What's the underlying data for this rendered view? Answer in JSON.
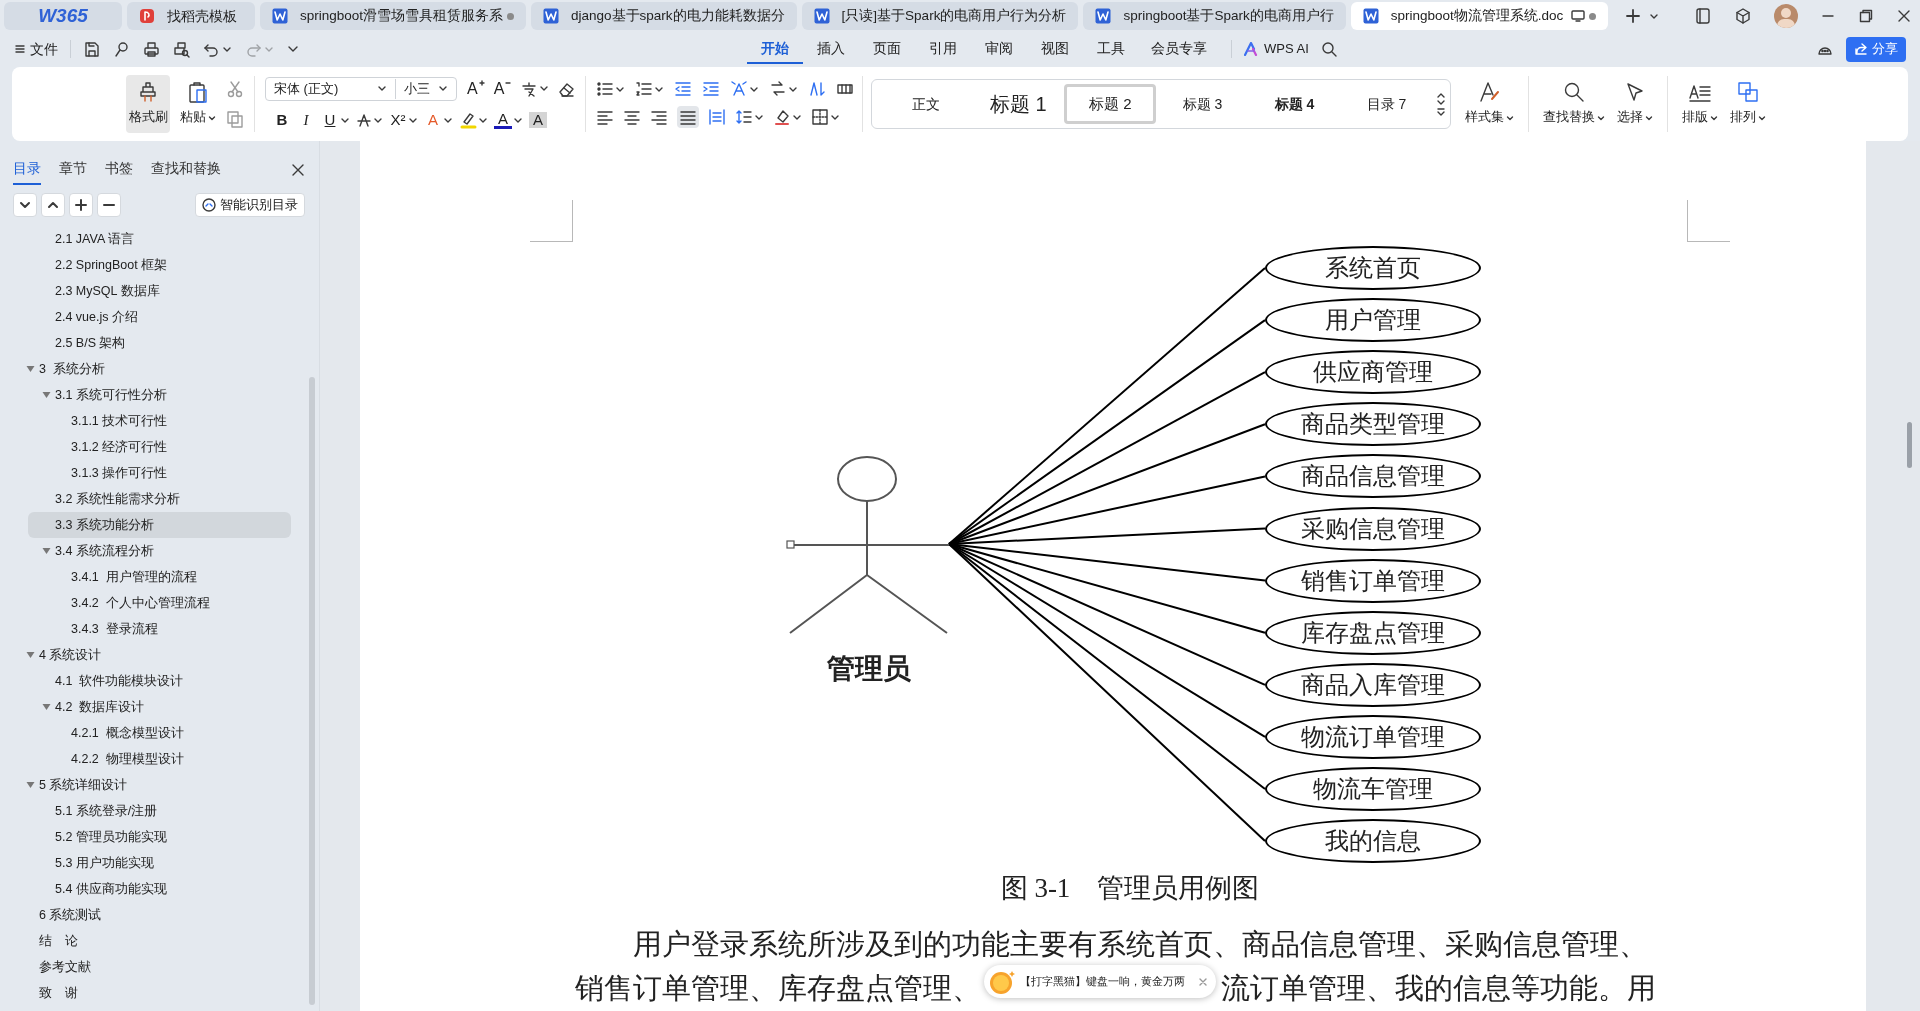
{
  "tabs": [
    {
      "kind": "logo",
      "label": "W365",
      "selected": false
    },
    {
      "kind": "templates",
      "label": "找稻壳模板",
      "selected": false
    },
    {
      "kind": "doc",
      "label": "springboot滑雪场雪具租赁服务系",
      "selected": false,
      "modified": true
    },
    {
      "kind": "doc",
      "label": "django基于spark的电力能耗数据分",
      "selected": false,
      "modified": false
    },
    {
      "kind": "doc",
      "label": "[只读]基于Spark的电商用户行为分析",
      "selected": false,
      "modified": false
    },
    {
      "kind": "doc",
      "label": "springboot基于Spark的电商用户行",
      "selected": false,
      "modified": false
    },
    {
      "kind": "doc",
      "label": "springboot物流管理系统.doc",
      "selected": true,
      "modified": true
    }
  ],
  "file_menu": "文件",
  "ribbon_tabs": [
    {
      "label": "开始",
      "selected": true
    },
    {
      "label": "插入",
      "selected": false
    },
    {
      "label": "页面",
      "selected": false
    },
    {
      "label": "引用",
      "selected": false
    },
    {
      "label": "审阅",
      "selected": false
    },
    {
      "label": "视图",
      "selected": false
    },
    {
      "label": "工具",
      "selected": false
    },
    {
      "label": "会员专享",
      "selected": false
    }
  ],
  "wps_ai": "WPS AI",
  "share": "分享",
  "ribbon": {
    "format_painter": {
      "label": "格式刷",
      "pressed": true
    },
    "paste": "粘贴",
    "font": "宋体 (正文)",
    "font_size": "小三",
    "font_buttons": [
      {
        "kind": "grow",
        "label": "A"
      },
      {
        "kind": "shrink",
        "label": "A"
      }
    ],
    "format_buttons": [
      {
        "kind": "bold",
        "label": "B"
      },
      {
        "kind": "italic",
        "label": "I"
      },
      {
        "kind": "underline",
        "label": "U"
      },
      {
        "kind": "superscript",
        "label": "X²"
      },
      {
        "kind": "effect",
        "label": "A"
      },
      {
        "kind": "color",
        "label": "A"
      },
      {
        "kind": "shade",
        "label": "A"
      }
    ],
    "styles": [
      {
        "kind": "body",
        "label": "正文",
        "selected": false
      },
      {
        "kind": "h1",
        "label": "标题 1",
        "selected": false
      },
      {
        "kind": "h2",
        "label": "标题 2",
        "selected": true
      },
      {
        "kind": "h3",
        "label": "标题 3",
        "selected": false
      },
      {
        "kind": "h4",
        "label": "标题 4",
        "selected": false
      },
      {
        "kind": "toc",
        "label": "目录 7",
        "selected": false
      }
    ],
    "style_set": "样式集",
    "find_replace": "查找替换",
    "select": "选择",
    "layout": "排版",
    "arrange": "排列"
  },
  "sidebar": {
    "tabs": [
      {
        "label": "目录",
        "selected": true
      },
      {
        "label": "章节",
        "selected": false
      },
      {
        "label": "书签",
        "selected": false
      },
      {
        "label": "查找和替换",
        "selected": false
      }
    ],
    "smart_toc": "智能识别目录",
    "toc": [
      {
        "children": [
          {
            "label": "2.1 JAVA 语言",
            "selected": false
          },
          {
            "label": "2.2 SpringBoot 框架",
            "selected": false
          },
          {
            "label": "2.3 MySQL 数据库",
            "selected": false
          },
          {
            "label": "2.4 vue.js 介绍",
            "selected": false
          },
          {
            "label": "2.5 B/S 架构",
            "selected": false
          }
        ]
      },
      {
        "label": "3  系统分析",
        "selected": false,
        "expanded": true,
        "children": [
          {
            "label": "3.1 系统可行性分析",
            "selected": false,
            "expanded": true,
            "children": [
              {
                "label": "3.1.1 技术可行性",
                "selected": false
              },
              {
                "label": "3.1.2 经济可行性",
                "selected": false
              },
              {
                "label": "3.1.3 操作可行性",
                "selected": false
              }
            ]
          },
          {
            "label": "3.2 系统性能需求分析",
            "selected": false
          },
          {
            "label": "3.3 系统功能分析",
            "selected": true
          },
          {
            "label": "3.4 系统流程分析",
            "selected": false,
            "expanded": true,
            "children": [
              {
                "label": "3.4.1  用户管理的流程",
                "selected": false
              },
              {
                "label": "3.4.2  个人中心管理流程",
                "selected": false
              },
              {
                "label": "3.4.3  登录流程",
                "selected": false
              }
            ]
          }
        ]
      },
      {
        "label": "4 系统设计",
        "selected": false,
        "expanded": true,
        "children": [
          {
            "label": "4.1  软件功能模块设计",
            "selected": false
          },
          {
            "label": "4.2  数据库设计",
            "selected": false,
            "expanded": true,
            "children": [
              {
                "label": "4.2.1  概念模型设计",
                "selected": false
              },
              {
                "label": "4.2.2  物理模型设计",
                "selected": false
              }
            ]
          }
        ]
      },
      {
        "label": "5 系统详细设计",
        "selected": false,
        "expanded": true,
        "children": [
          {
            "label": "5.1 系统登录/注册",
            "selected": false
          },
          {
            "label": "5.2 管理员功能实现",
            "selected": false
          },
          {
            "label": "5.3 用户功能实现",
            "selected": false
          },
          {
            "label": "5.4 供应商功能实现",
            "selected": false
          }
        ]
      },
      {
        "label": "6 系统测试",
        "selected": false
      },
      {
        "label": "结　论",
        "selected": false
      },
      {
        "label": "参考文献",
        "selected": false
      },
      {
        "label": "致　谢",
        "selected": false
      }
    ]
  },
  "diagram": {
    "actor": "管理员",
    "use_cases": [
      "系统首页",
      "用户管理",
      "供应商管理",
      "商品类型管理",
      "商品信息管理",
      "采购信息管理",
      "销售订单管理",
      "库存盘点管理",
      "商品入库管理",
      "物流订单管理",
      "物流车管理",
      "我的信息"
    ]
  },
  "caption": "图 3-1　管理员用例图",
  "body_lines": [
    "用户登录系统所涉及到的功能主要有系统首页、商品信息管理、采购信息管理、",
    "销售订单管理、库存盘点管理、",
    "流订单管理、我的信息等功能。用"
  ],
  "popup": {
    "text": "【打字黑猫】键盘一响，黄金万两"
  }
}
